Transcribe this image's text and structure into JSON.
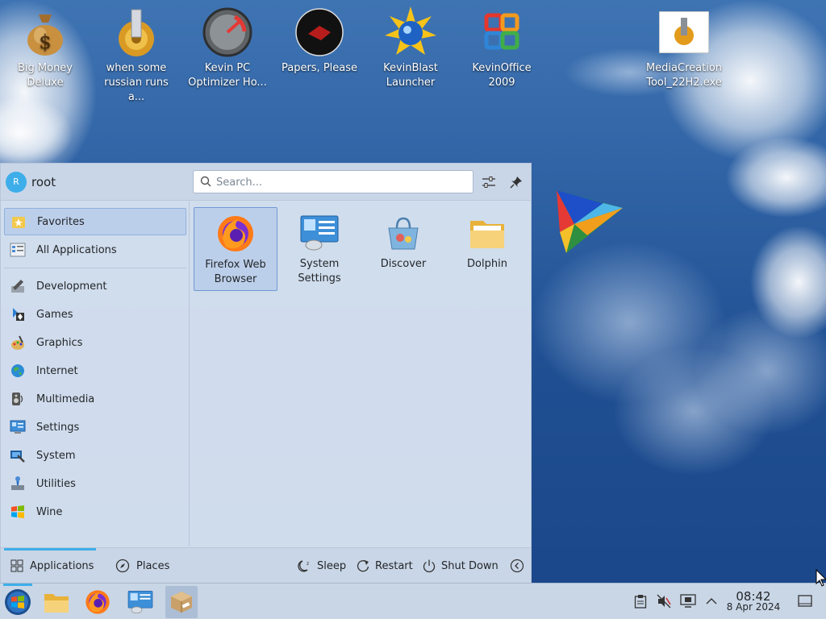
{
  "desktop": {
    "icons": [
      {
        "label": "Big Money Deluxe",
        "icon": "money-bag-icon"
      },
      {
        "label": "when some russian runs a...",
        "icon": "gear-cogs-icon"
      },
      {
        "label": "Kevin PC Optimizer Ho...",
        "icon": "speedometer-icon"
      },
      {
        "label": "Papers, Please",
        "icon": "red-stamp-disc-icon"
      },
      {
        "label": "KevinBlast Launcher",
        "icon": "sun-globe-icon"
      },
      {
        "label": "KevinOffice 2009",
        "icon": "office-logo-icon"
      },
      {
        "label": "MediaCreation Tool_22H2.exe",
        "icon": "installer-icon"
      }
    ]
  },
  "launcher": {
    "user": {
      "initial": "R",
      "name": "root"
    },
    "search": {
      "placeholder": "Search..."
    },
    "header_buttons": {
      "configure": "configure-icon",
      "pin": "pin-icon"
    },
    "categories": [
      {
        "label": "Favorites",
        "icon": "star-folder-icon",
        "active": true
      },
      {
        "label": "All Applications",
        "icon": "app-grid-icon"
      },
      {
        "label": "Development",
        "icon": "development-icon"
      },
      {
        "label": "Games",
        "icon": "games-icon"
      },
      {
        "label": "Graphics",
        "icon": "graphics-icon"
      },
      {
        "label": "Internet",
        "icon": "internet-globe-icon"
      },
      {
        "label": "Multimedia",
        "icon": "multimedia-icon"
      },
      {
        "label": "Settings",
        "icon": "settings-panel-icon"
      },
      {
        "label": "System",
        "icon": "system-icon"
      },
      {
        "label": "Utilities",
        "icon": "utilities-icon"
      },
      {
        "label": "Wine",
        "icon": "wine-windows-icon"
      }
    ],
    "apps": [
      {
        "label": "Firefox Web Browser",
        "icon": "firefox-icon",
        "active": true
      },
      {
        "label": "System Settings",
        "icon": "system-settings-icon"
      },
      {
        "label": "Discover",
        "icon": "discover-icon"
      },
      {
        "label": "Dolphin",
        "icon": "folder-icon"
      }
    ],
    "footer": {
      "tabs": [
        {
          "label": "Applications",
          "icon": "grid-icon",
          "active": true
        },
        {
          "label": "Places",
          "icon": "compass-icon"
        }
      ],
      "power": [
        {
          "label": "Sleep",
          "icon": "sleep-icon"
        },
        {
          "label": "Restart",
          "icon": "restart-icon"
        },
        {
          "label": "Shut Down",
          "icon": "power-icon"
        }
      ],
      "more": "chevron-left-icon"
    }
  },
  "taskbar": {
    "launchers": [
      "start-orb-icon",
      "folder-icon",
      "firefox-icon",
      "system-settings-icon",
      "package-icon"
    ],
    "tray": [
      "clipboard-icon",
      "volume-muted-icon",
      "display-icon",
      "chevron-up-icon"
    ],
    "clock": {
      "time": "08:42",
      "date": "8 Apr 2024"
    },
    "show_desktop": "show-desktop-icon"
  },
  "colors": {
    "accent": "#3daee9",
    "panel": "#c9d6e6",
    "launcher_bg": "#d6e1f0",
    "highlight": "#bccfea"
  }
}
